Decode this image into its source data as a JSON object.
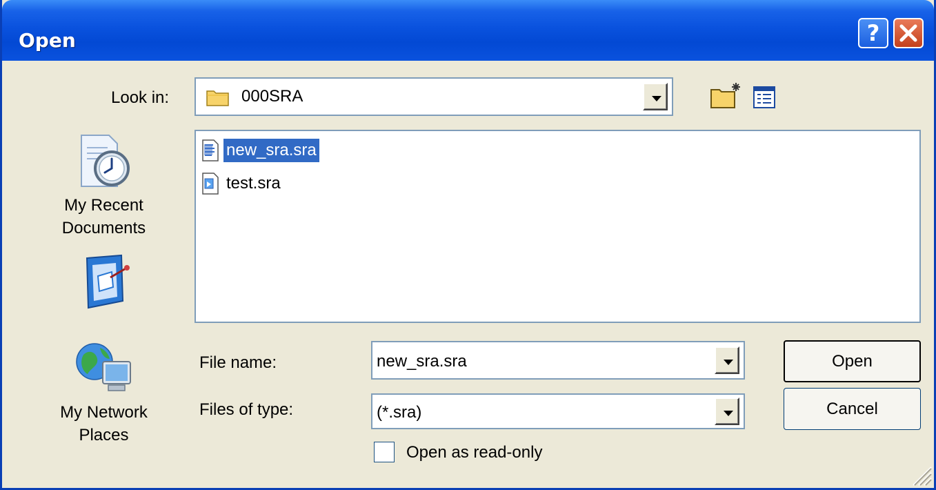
{
  "window": {
    "title": "Open"
  },
  "look_in": {
    "label": "Look in:",
    "value": "000SRA"
  },
  "places": [
    {
      "label": "My Recent Documents",
      "icon": "recent-documents-icon"
    },
    {
      "label": "",
      "icon": "desktop-icon"
    },
    {
      "label": "My Network Places",
      "icon": "network-places-icon"
    }
  ],
  "files": [
    {
      "name": "new_sra.sra",
      "selected": true
    },
    {
      "name": "test.sra",
      "selected": false
    }
  ],
  "file_name": {
    "label": "File name:",
    "value": "new_sra.sra"
  },
  "file_type": {
    "label": "Files of type:",
    "value": "(*.sra)"
  },
  "read_only": {
    "label": "Open as read-only",
    "checked": false
  },
  "buttons": {
    "open": "Open",
    "cancel": "Cancel"
  },
  "colors": {
    "title_bar": "#0a52de",
    "selection": "#316ac5",
    "dialog_bg": "#ece9d8",
    "close_button": "#c4401c"
  }
}
